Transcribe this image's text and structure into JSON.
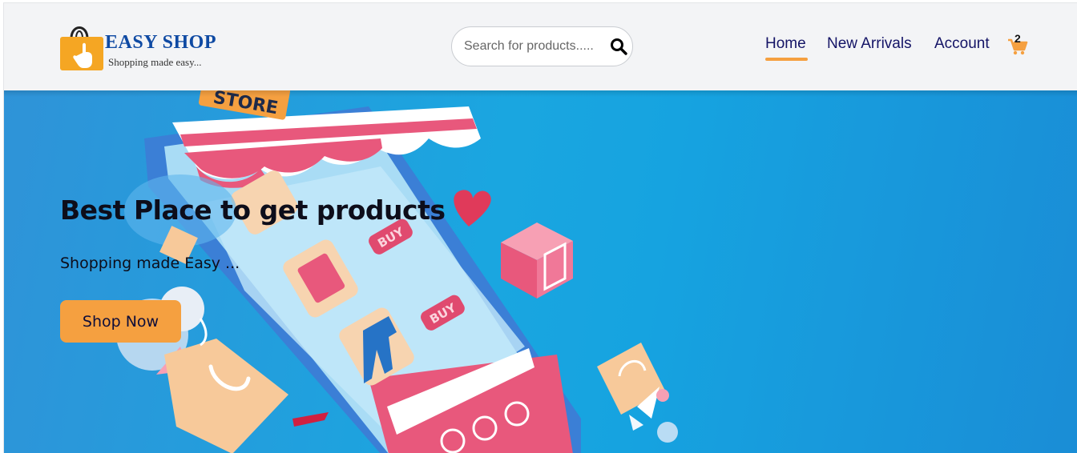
{
  "brand": {
    "name": "EASY SHOP",
    "tagline": "Shopping made easy..."
  },
  "search": {
    "placeholder": "Search for products.....",
    "icon": "search-icon"
  },
  "nav": {
    "items": [
      {
        "label": "Home",
        "active": true
      },
      {
        "label": "New Arrivals",
        "active": false
      },
      {
        "label": "Account",
        "active": false
      }
    ],
    "cart": {
      "icon": "cart-icon",
      "count": "2"
    }
  },
  "hero": {
    "title": "Best Place to get products",
    "subtitle": "Shopping made Easy ...",
    "cta_label": "Shop Now",
    "art_labels": {
      "store_sign": "STORE",
      "buy_1": "BUY",
      "buy_2": "BUY"
    }
  },
  "colors": {
    "accent": "#f5a040",
    "nav_text": "#141466",
    "brand_blue": "#0f4aa3",
    "hero_blue": "#1aa6e0"
  }
}
